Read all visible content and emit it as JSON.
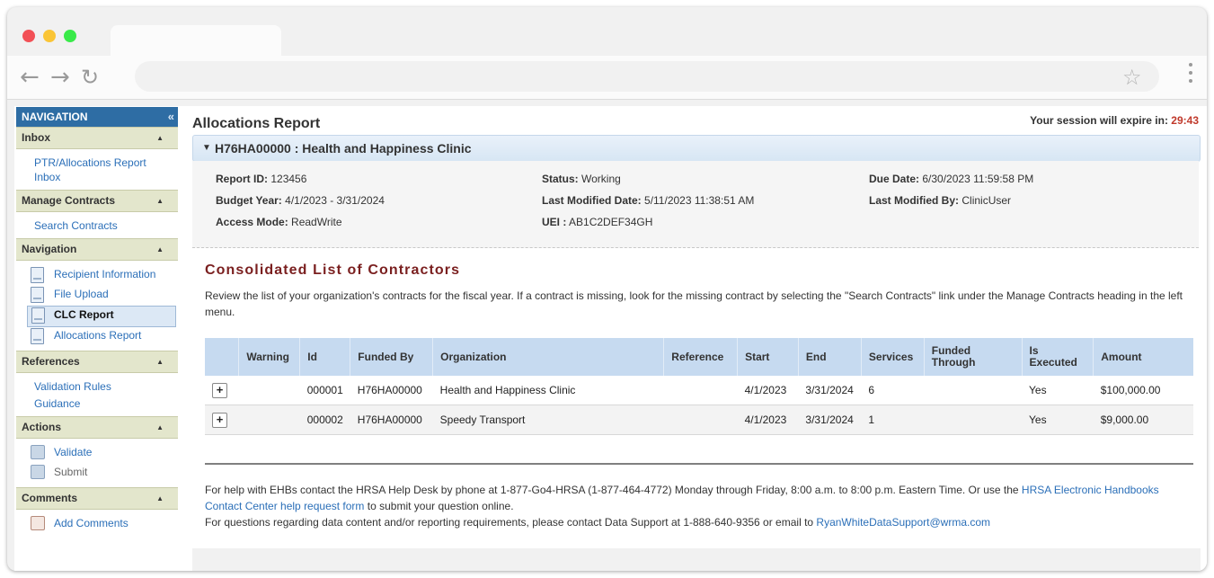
{
  "browser": {
    "nav_icons": [
      "back-arrow-icon",
      "forward-arrow-icon",
      "reload-icon"
    ],
    "star_icon": "star-icon",
    "menu_icon": "kebab-menu-icon"
  },
  "sidebar": {
    "title": "NAVIGATION",
    "collapse": "«",
    "sections": [
      {
        "heading": "Inbox",
        "items": [
          {
            "label": "PTR/Allocations Report Inbox"
          }
        ]
      },
      {
        "heading": "Manage Contracts",
        "items": [
          {
            "label": "Search Contracts"
          }
        ]
      },
      {
        "heading": "Navigation",
        "items": [
          {
            "label": "Recipient Information"
          },
          {
            "label": "File Upload"
          },
          {
            "label": "CLC Report",
            "selected": true
          },
          {
            "label": "Allocations Report"
          }
        ]
      },
      {
        "heading": "References",
        "items": [
          {
            "label": "Validation Rules"
          },
          {
            "label": "Guidance"
          }
        ]
      },
      {
        "heading": "Actions",
        "items": [
          {
            "label": "Validate"
          },
          {
            "label": "Submit"
          }
        ]
      },
      {
        "heading": "Comments",
        "items": [
          {
            "label": "Add Comments"
          }
        ]
      }
    ]
  },
  "header": {
    "page_title": "Allocations Report",
    "session_label": "Your session will expire in:",
    "session_time": "29:43"
  },
  "grant": {
    "title": "H76HA00000 : Health and Happiness Clinic",
    "fields": {
      "report_id_label": "Report ID:",
      "report_id": "123456",
      "budget_year_label": "Budget Year:",
      "budget_year": "4/1/2023 - 3/31/2024",
      "access_mode_label": "Access Mode:",
      "access_mode": "ReadWrite",
      "status_label": "Status:",
      "status": "Working",
      "last_modified_date_label": "Last Modified Date:",
      "last_modified_date": "5/11/2023 11:38:51 AM",
      "uei_label": "UEI :",
      "uei": "AB1C2DEF34GH",
      "due_date_label": "Due Date:",
      "due_date": "6/30/2023 11:59:58 PM",
      "last_modified_by_label": "Last Modified By:",
      "last_modified_by": "ClinicUser"
    }
  },
  "contractors": {
    "title": "Consolidated List of Contractors",
    "description": "Review the list of your organization's contracts for the fiscal year. If a contract is missing, look for the missing contract by selecting the \"Search Contracts\" link under the Manage Contracts heading in the left menu.",
    "columns": [
      "",
      "Warning",
      "Id",
      "Funded By",
      "Organization",
      "Reference",
      "Start",
      "End",
      "Services",
      "Funded Through",
      "Is Executed",
      "Amount"
    ],
    "rows": [
      {
        "expand": "+",
        "warning": "",
        "id": "000001",
        "funded_by": "H76HA00000",
        "organization": "Health and Happiness Clinic",
        "reference": "",
        "start": "4/1/2023",
        "end": "3/31/2024",
        "services": "6",
        "funded_through": "",
        "is_executed": "Yes",
        "amount": "$100,000.00"
      },
      {
        "expand": "+",
        "warning": "",
        "id": "000002",
        "funded_by": "H76HA00000",
        "organization": "Speedy Transport",
        "reference": "",
        "start": "4/1/2023",
        "end": "3/31/2024",
        "services": "1",
        "funded_through": "",
        "is_executed": "Yes",
        "amount": "$9,000.00"
      }
    ]
  },
  "footer": {
    "help_text_1": "For help with EHBs contact the HRSA Help Desk by phone at 1-877-Go4-HRSA (1-877-464-4772) Monday through Friday, 8:00 a.m. to 8:00 p.m. Eastern Time. Or use the",
    "help_link": "HRSA Electronic Handbooks Contact Center help request form",
    "help_text_2": "to submit your question online.",
    "data_text": "For questions regarding data content and/or reporting requirements, please contact Data Support at 1-888-640-9356 or email to",
    "data_email": "RyanWhiteDataSupport@wrma.com"
  }
}
